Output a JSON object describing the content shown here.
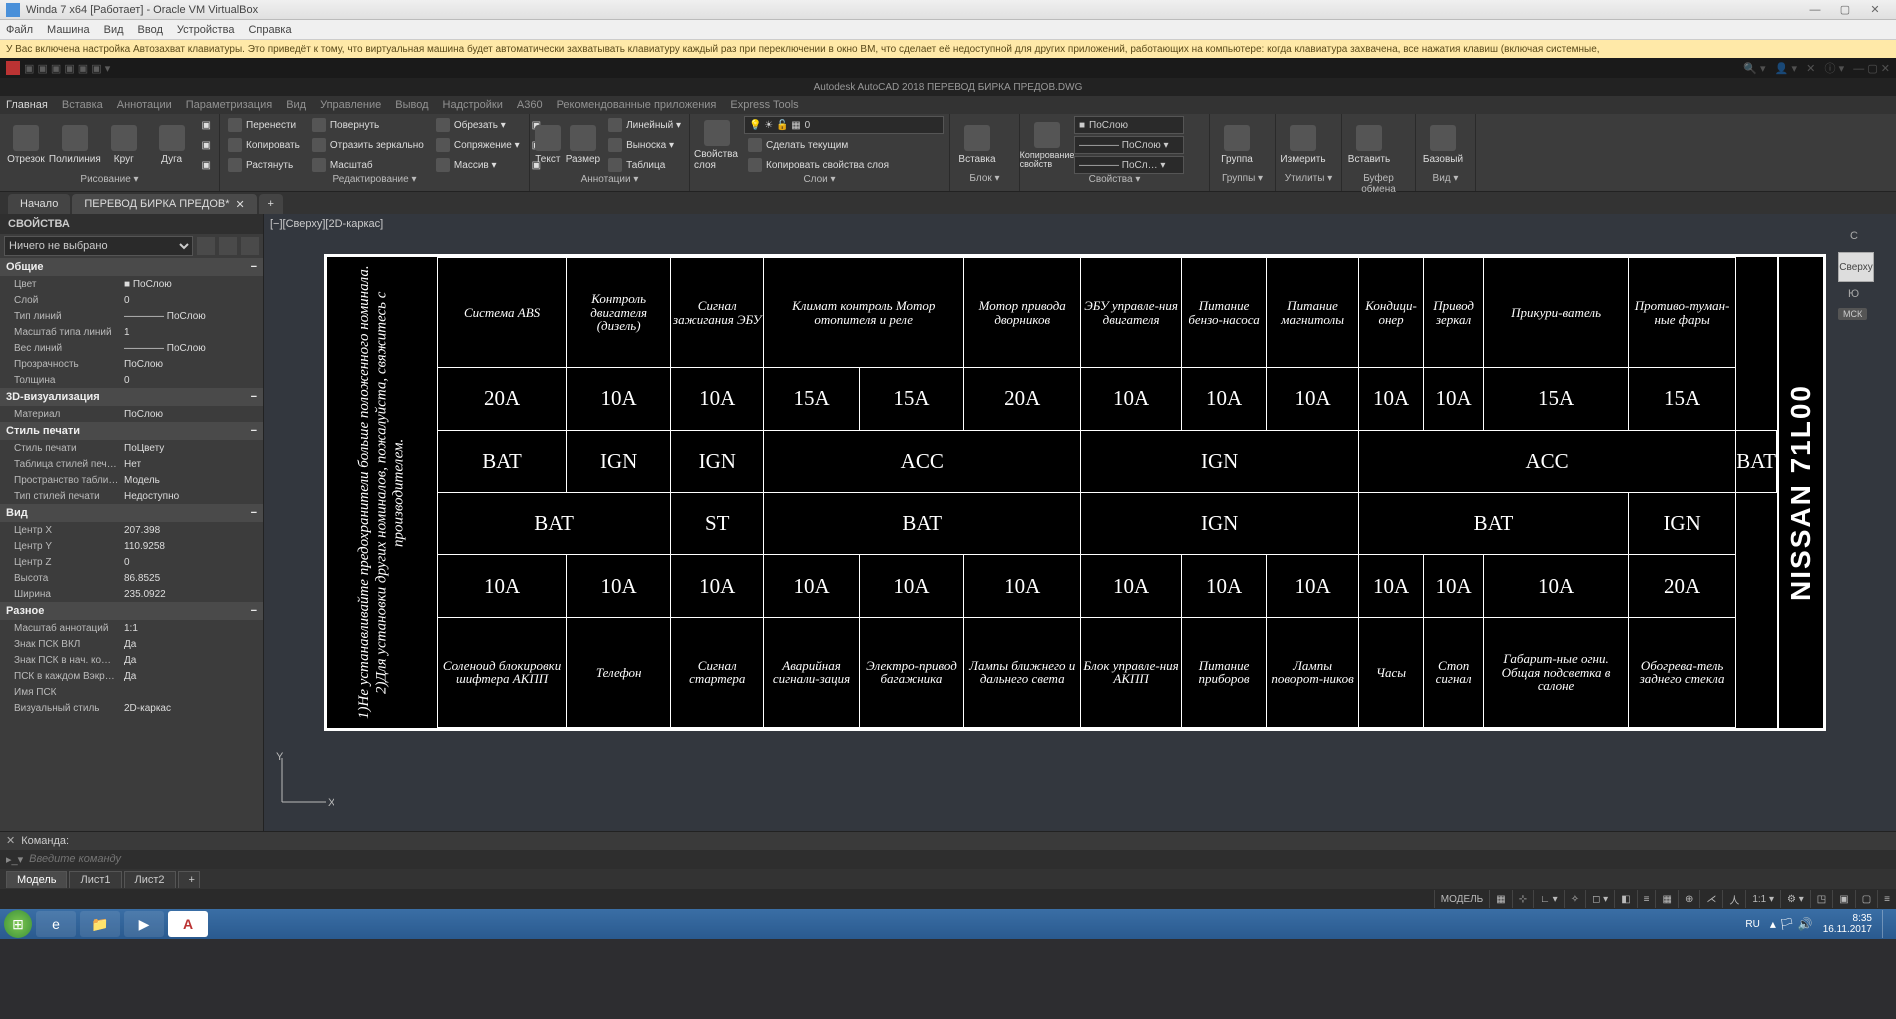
{
  "vb": {
    "title": "Winda 7 x64 [Работает] - Oracle VM VirtualBox",
    "menu": [
      "Файл",
      "Машина",
      "Вид",
      "Ввод",
      "Устройства",
      "Справка"
    ]
  },
  "kb_warning": "У Вас включена настройка Автозахват клавиатуры. Это приведёт к тому, что виртуальная машина будет автоматически захватывать клавиатуру каждый раз при переключении в окно ВМ, что сделает её недоступной для других приложений, работающих на компьютере: когда клавиатура захвачена, все нажатия клавиш (включая системные,",
  "vm_doc_title": "Autodesk AutoCAD 2018   ПЕРЕВОД БИРКА ПРЕДОВ.DWG",
  "vm_tabs": [
    "Главная",
    "Вставка",
    "Аннотации",
    "Параметризация",
    "Вид",
    "Управление",
    "Вывод",
    "Надстройки",
    "A360",
    "Рекомендованные приложения",
    "Express Tools"
  ],
  "ribbon": {
    "draw": {
      "label": "Рисование ▾",
      "items": [
        "Отрезок",
        "Полилиния",
        "Круг",
        "Дуга"
      ]
    },
    "edit": {
      "label": "Редактирование ▾",
      "move": "Перенести",
      "copy": "Копировать",
      "stretch": "Растянуть",
      "rotate": "Повернуть",
      "mirror": "Отразить зеркально",
      "scale": "Масштаб",
      "trim": "Обрезать ▾",
      "fillet": "Сопряжение ▾",
      "array": "Массив ▾"
    },
    "annot": {
      "label": "Аннотации ▾",
      "text": "Текст",
      "dim": "Размер",
      "linear": "Линейный ▾",
      "leader": "Выноска ▾",
      "table": "Таблица"
    },
    "layers": {
      "label": "Слои ▾",
      "props": "Свойства слоя",
      "val": "0",
      "current": "Сделать текущим",
      "match": "Копировать свойства слоя"
    },
    "block": {
      "label": "Блок ▾",
      "insert": "Вставка"
    },
    "props": {
      "label": "Свойства ▾",
      "copy": "Копирование свойств",
      "bylayer": "ПоСлою",
      "bylayer2": "———— ПоСлою ▾",
      "bylayer3": "———— ПоСл… ▾"
    },
    "groups": {
      "label": "Группы ▾",
      "g": "Группа"
    },
    "util": {
      "label": "Утилиты ▾",
      "meas": "Измерить"
    },
    "clip": {
      "label": "Буфер обмена",
      "paste": "Вставить"
    },
    "view": {
      "label": "Вид ▾",
      "base": "Базовый"
    }
  },
  "filetabs": {
    "start": "Начало",
    "doc": "ПЕРЕВОД БИРКА ПРЕДОВ*",
    "plus": "+"
  },
  "props_panel": {
    "title": "СВОЙСТВА",
    "selection": "Ничего не выбрано",
    "groups": {
      "general": {
        "h": "Общие",
        "rows": [
          [
            "Цвет",
            "■ ПоСлою"
          ],
          [
            "Слой",
            "0"
          ],
          [
            "Тип линий",
            "———— ПоСлою"
          ],
          [
            "Масштаб типа линий",
            "1"
          ],
          [
            "Вес линий",
            "———— ПоСлою"
          ],
          [
            "Прозрачность",
            "ПоСлою"
          ],
          [
            "Толщина",
            "0"
          ]
        ]
      },
      "viz": {
        "h": "3D-визуализация",
        "rows": [
          [
            "Материал",
            "ПоСлою"
          ]
        ]
      },
      "print": {
        "h": "Стиль печати",
        "rows": [
          [
            "Стиль печати",
            "ПоЦвету"
          ],
          [
            "Таблица стилей печ…",
            "Нет"
          ],
          [
            "Пространство табли…",
            "Модель"
          ],
          [
            "Тип стилей печати",
            "Недоступно"
          ]
        ]
      },
      "view": {
        "h": "Вид",
        "rows": [
          [
            "Центр X",
            "207.398"
          ],
          [
            "Центр Y",
            "110.9258"
          ],
          [
            "Центр Z",
            "0"
          ],
          [
            "Высота",
            "86.8525"
          ],
          [
            "Ширина",
            "235.0922"
          ]
        ]
      },
      "misc": {
        "h": "Разное",
        "rows": [
          [
            "Масштаб аннотаций",
            "1:1"
          ],
          [
            "Знак ПСК ВКЛ",
            "Да"
          ],
          [
            "Знак ПСК в нач. ко…",
            "Да"
          ],
          [
            "ПСК в каждом Вэкр…",
            "Да"
          ],
          [
            "Имя ПСК",
            ""
          ],
          [
            "Визуальный стиль",
            "2D-каркас"
          ]
        ]
      }
    }
  },
  "canvas": {
    "head": "[−][Сверху][2D-каркас]",
    "cube": "Сверху",
    "cube_c": "С",
    "cube_u": "Ю",
    "wcs": "МСК"
  },
  "drawing": {
    "note": "1)Не устанавливайте предохранители больше положенного номинала.\n2)Для установки других номиналов, пожалуйста, свяжитесь с производителем.",
    "brand": "NISSAN 71L00",
    "row1_desc": [
      "Система ABS",
      "Контроль двигателя (дизель)",
      "Сигнал зажигания ЭБУ",
      "Климат контроль Мотор отопителя и реле",
      "Мотор привода дворников",
      "ЭБУ управле-ния двигателя",
      "Питание бензо-насоса",
      "Питание магнитолы",
      "Кондици-онер",
      "Привод зеркал",
      "Прикури-ватель",
      "Противо-туман-ные фары"
    ],
    "row2_amp": [
      "20A",
      "10A",
      "10A",
      "15A",
      "15A",
      "20A",
      "10A",
      "10A",
      "10A",
      "10A",
      "10A",
      "15A",
      "15A"
    ],
    "row3_src": [
      "BAT",
      "IGN",
      "IGN",
      "ACC",
      "IGN",
      "ACC",
      "BAT"
    ],
    "row3_span": [
      1,
      1,
      1,
      3,
      3,
      4,
      1
    ],
    "row4_src": [
      "BAT",
      "ST",
      "BAT",
      "IGN",
      "BAT",
      "IGN"
    ],
    "row4_span": [
      2,
      1,
      3,
      3,
      3,
      1
    ],
    "row5_amp": [
      "10A",
      "10A",
      "10A",
      "10A",
      "10A",
      "10A",
      "10A",
      "10A",
      "10A",
      "10A",
      "10A",
      "10A",
      "20A"
    ],
    "row6_desc": [
      "Соленоид блокировки шифтера АКПП",
      "Телефон",
      "Сигнал стартера",
      "Аварийная сигнали-зация",
      "Электро-привод багажника",
      "Лампы ближнего и дальнего света",
      "Блок управле-ния АКПП",
      "Питание приборов",
      "Лампы поворот-ников",
      "Часы",
      "Стоп сигнал",
      "Габарит-ные огни. Общая подсветка в салоне",
      "Обогрева-тель заднего стекла"
    ]
  },
  "cmd": {
    "label": "Команда:",
    "placeholder": "Введите команду"
  },
  "modeltabs": [
    "Модель",
    "Лист1",
    "Лист2"
  ],
  "statusbar": {
    "model": "МОДЕЛЬ",
    "scale": "1:1 ▾",
    "lang": "RU"
  },
  "taskbar": {
    "time": "8:35",
    "date": "16.11.2017"
  }
}
